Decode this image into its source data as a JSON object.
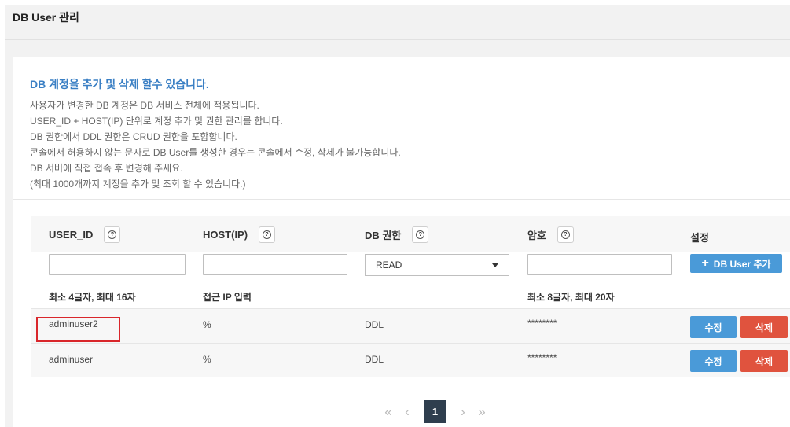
{
  "page": {
    "title": "DB User 관리"
  },
  "notice": {
    "title": "DB 계정을 추가 및 삭제 할수 있습니다.",
    "lines": [
      "사용자가 변경한 DB 계정은 DB 서비스 전체에 적용됩니다.",
      "USER_ID + HOST(IP) 단위로 계정 추가 및 권한 관리를 합니다.",
      "DB 권한에서 DDL 권한은 CRUD 권한을 포함합니다.",
      "콘솔에서 허용하지 않는 문자로 DB User를 생성한 경우는 콘솔에서 수정, 삭제가 불가능합니다.",
      "DB 서버에 직접 접속 후 변경해 주세요.",
      "(최대 1000개까지 계정을 추가 및 조회 할 수 있습니다.)"
    ]
  },
  "table": {
    "headers": {
      "user_id": "USER_ID",
      "host": "HOST(IP)",
      "permission": "DB 권한",
      "password": "암호",
      "settings": "설정"
    },
    "inputs": {
      "user_id_value": "",
      "host_value": "",
      "permission_selected": "READ",
      "password_value": ""
    },
    "add_button": "DB User 추가",
    "hints": {
      "user_id": "최소 4글자, 최대 16자",
      "host": "접근 IP 입력",
      "password": "최소 8글자, 최대 20자"
    },
    "rows": [
      {
        "user_id": "adminuser2",
        "host": "%",
        "permission": "DDL",
        "password": "********",
        "edit": "수정",
        "delete": "삭제"
      },
      {
        "user_id": "adminuser",
        "host": "%",
        "permission": "DDL",
        "password": "********",
        "edit": "수정",
        "delete": "삭제"
      }
    ]
  },
  "pagination": {
    "first": "«",
    "prev": "‹",
    "current": "1",
    "next": "›",
    "last": "»"
  },
  "icons": {
    "help": "help-icon",
    "caret": "caret-down-icon",
    "plus": "plus-icon"
  },
  "colors": {
    "accent_blue": "#4a9ad8",
    "delete_red": "#e0533e",
    "notice_title": "#3a7fc4",
    "pager_active": "#2f3e4e",
    "highlight": "#d9262b"
  }
}
